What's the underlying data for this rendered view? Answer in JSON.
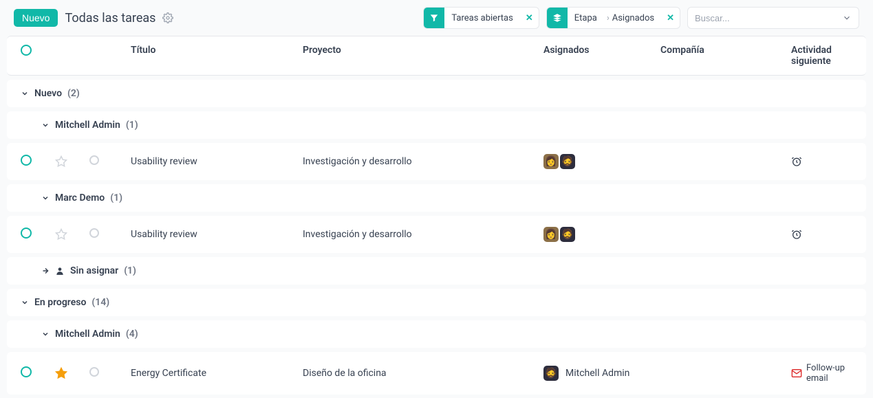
{
  "header": {
    "new_button": "Nuevo",
    "title": "Todas las tareas",
    "filter1": "Tareas abiertas",
    "filter2_left": "Etapa",
    "filter2_right": "Asignados",
    "search_placeholder": "Buscar..."
  },
  "columns": {
    "title": "Título",
    "project": "Proyecto",
    "assignees": "Asignados",
    "company": "Compañía",
    "next_activity": "Actividad siguiente"
  },
  "groups": [
    {
      "name": "Nuevo",
      "count": "(2)"
    }
  ],
  "subgroups": {
    "mitchell1": {
      "name": "Mitchell Admin",
      "count": "(1)"
    },
    "marc": {
      "name": "Marc Demo",
      "count": "(1)"
    },
    "unassigned": {
      "name": "Sin asignar",
      "count": "(1)"
    },
    "mitchell4": {
      "name": "Mitchell Admin",
      "count": "(4)"
    }
  },
  "group_progress": {
    "name": "En progreso",
    "count": "(14)"
  },
  "tasks": {
    "t1": {
      "title": "Usability review",
      "project": "Investigación y desarrollo"
    },
    "t2": {
      "title": "Usability review",
      "project": "Investigación y desarrollo"
    },
    "t3": {
      "title": "Energy Certificate",
      "project": "Diseño de la oficina",
      "assignee": "Mitchell Admin",
      "activity": "Follow-up email"
    }
  }
}
